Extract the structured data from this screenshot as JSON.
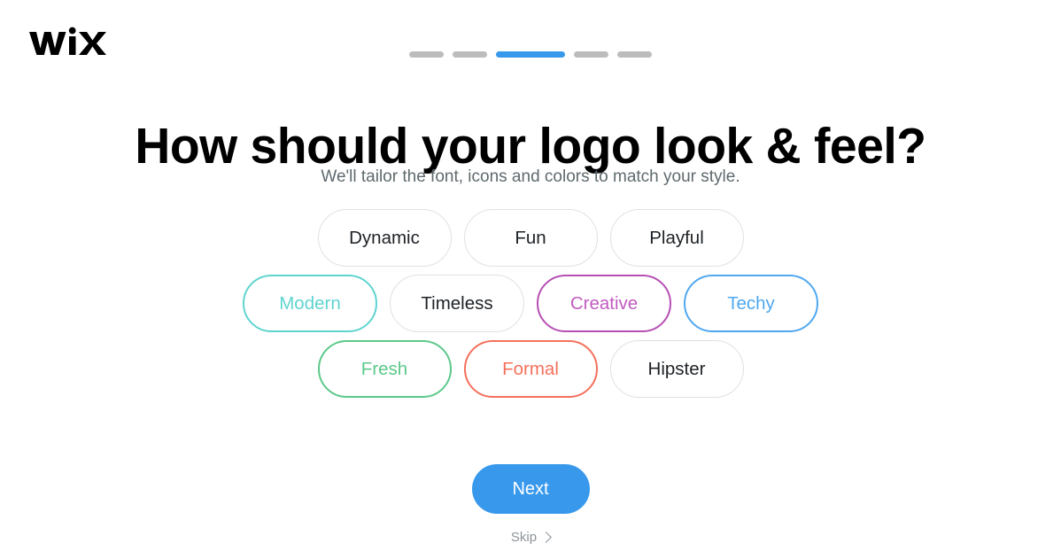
{
  "brand": {
    "logo_text": "WiX",
    "logo_icon": "wix-logo"
  },
  "progress": {
    "total_steps": 5,
    "current_step": 3,
    "active_color": "#3899ec",
    "inactive_color": "#bcbcbc",
    "steps": [
      {
        "index": 1,
        "active": false
      },
      {
        "index": 2,
        "active": false
      },
      {
        "index": 3,
        "active": true
      },
      {
        "index": 4,
        "active": false
      },
      {
        "index": 5,
        "active": false
      }
    ]
  },
  "header": {
    "title": "How should your logo look & feel?",
    "subtitle": "We'll tailor the font, icons and colors to match your style."
  },
  "styles": {
    "rows": [
      [
        {
          "label": "Dynamic",
          "selected": false,
          "color": "#1d2125",
          "border": "#dfe1e3"
        },
        {
          "label": "Fun",
          "selected": false,
          "color": "#1d2125",
          "border": "#dfe1e3"
        },
        {
          "label": "Playful",
          "selected": false,
          "color": "#1d2125",
          "border": "#dfe1e3"
        }
      ],
      [
        {
          "label": "Modern",
          "selected": true,
          "color": "#5fd4d0",
          "border": "#5fd4d0"
        },
        {
          "label": "Timeless",
          "selected": false,
          "color": "#1d2125",
          "border": "#dfe1e3"
        },
        {
          "label": "Creative",
          "selected": true,
          "color": "#c25cc0",
          "border": "#b64fb4"
        },
        {
          "label": "Techy",
          "selected": true,
          "color": "#4fa8f0",
          "border": "#4fa8f0"
        }
      ],
      [
        {
          "label": "Fresh",
          "selected": true,
          "color": "#5cc98a",
          "border": "#5cc98a"
        },
        {
          "label": "Formal",
          "selected": true,
          "color": "#f4705c",
          "border": "#f4705c"
        },
        {
          "label": "Hipster",
          "selected": false,
          "color": "#1d2125",
          "border": "#dfe1e3"
        }
      ]
    ]
  },
  "actions": {
    "next_label": "Next",
    "skip_label": "Skip",
    "skip_icon": "chevron-right-icon"
  }
}
